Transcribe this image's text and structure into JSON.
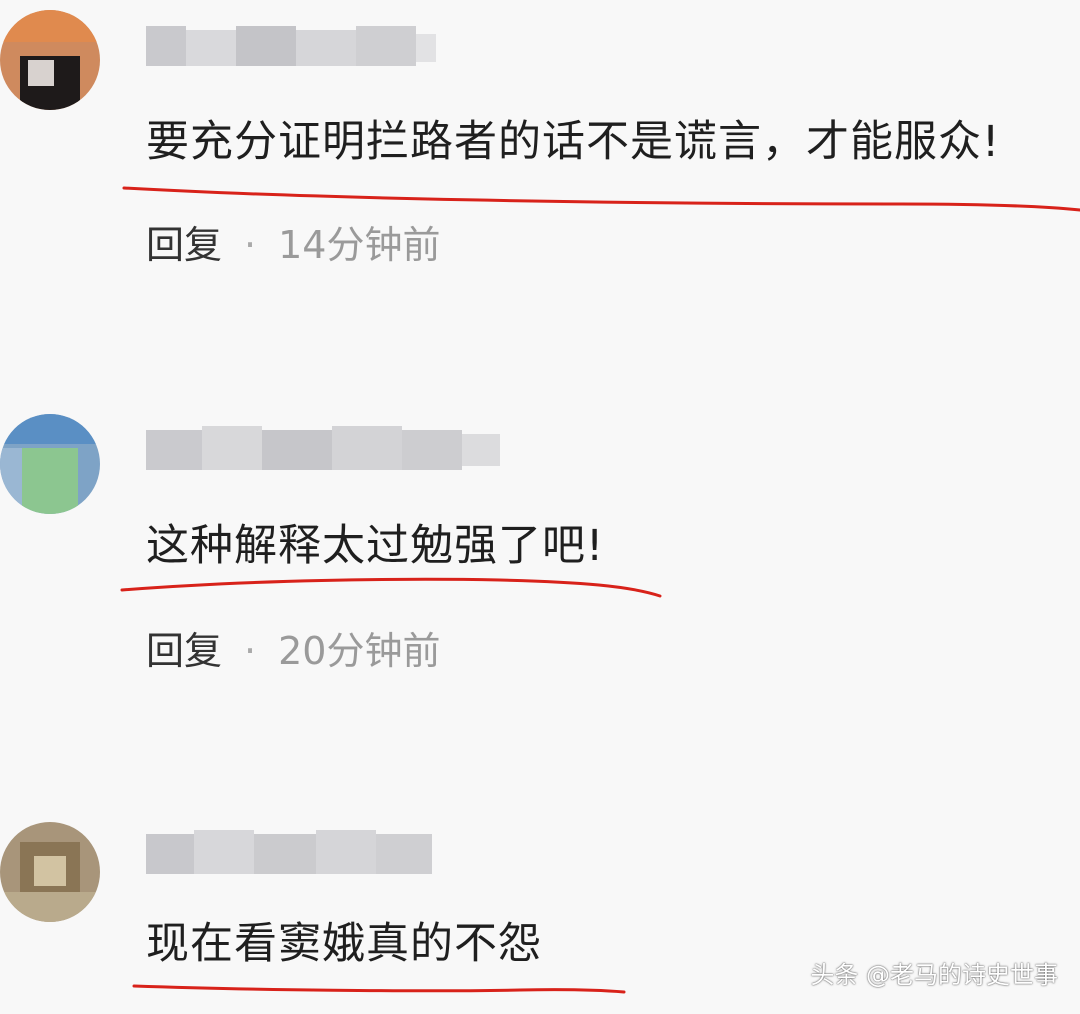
{
  "comments": [
    {
      "text": "要充分证明拦路者的话不是谎言，才能服众!",
      "reply_label": "回复",
      "separator": "·",
      "time": "14分钟前"
    },
    {
      "text": "这种解释太过勉强了吧!",
      "reply_label": "回复",
      "separator": "·",
      "time": "20分钟前"
    },
    {
      "text": "现在看窦娥真的不怨"
    }
  ],
  "watermark": "头条 @老马的诗史世事",
  "colors": {
    "underline": "#d8221a",
    "background": "#f8f8f8",
    "meta_time": "#9a9a9a"
  }
}
